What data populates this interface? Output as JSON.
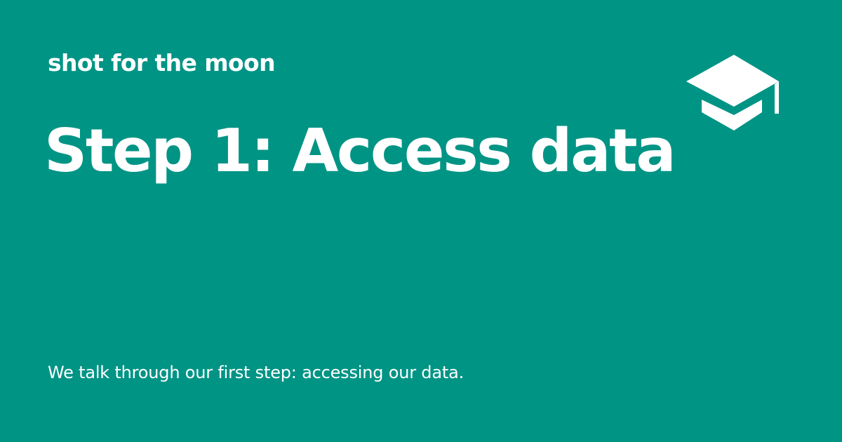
{
  "card": {
    "site_name": "shot for the moon",
    "title": "Step 1: Access data",
    "description": "We talk through our first step: accessing our data.",
    "logo_icon": "graduation-cap-icon",
    "colors": {
      "background": "#009485",
      "text": "#ffffff"
    }
  }
}
